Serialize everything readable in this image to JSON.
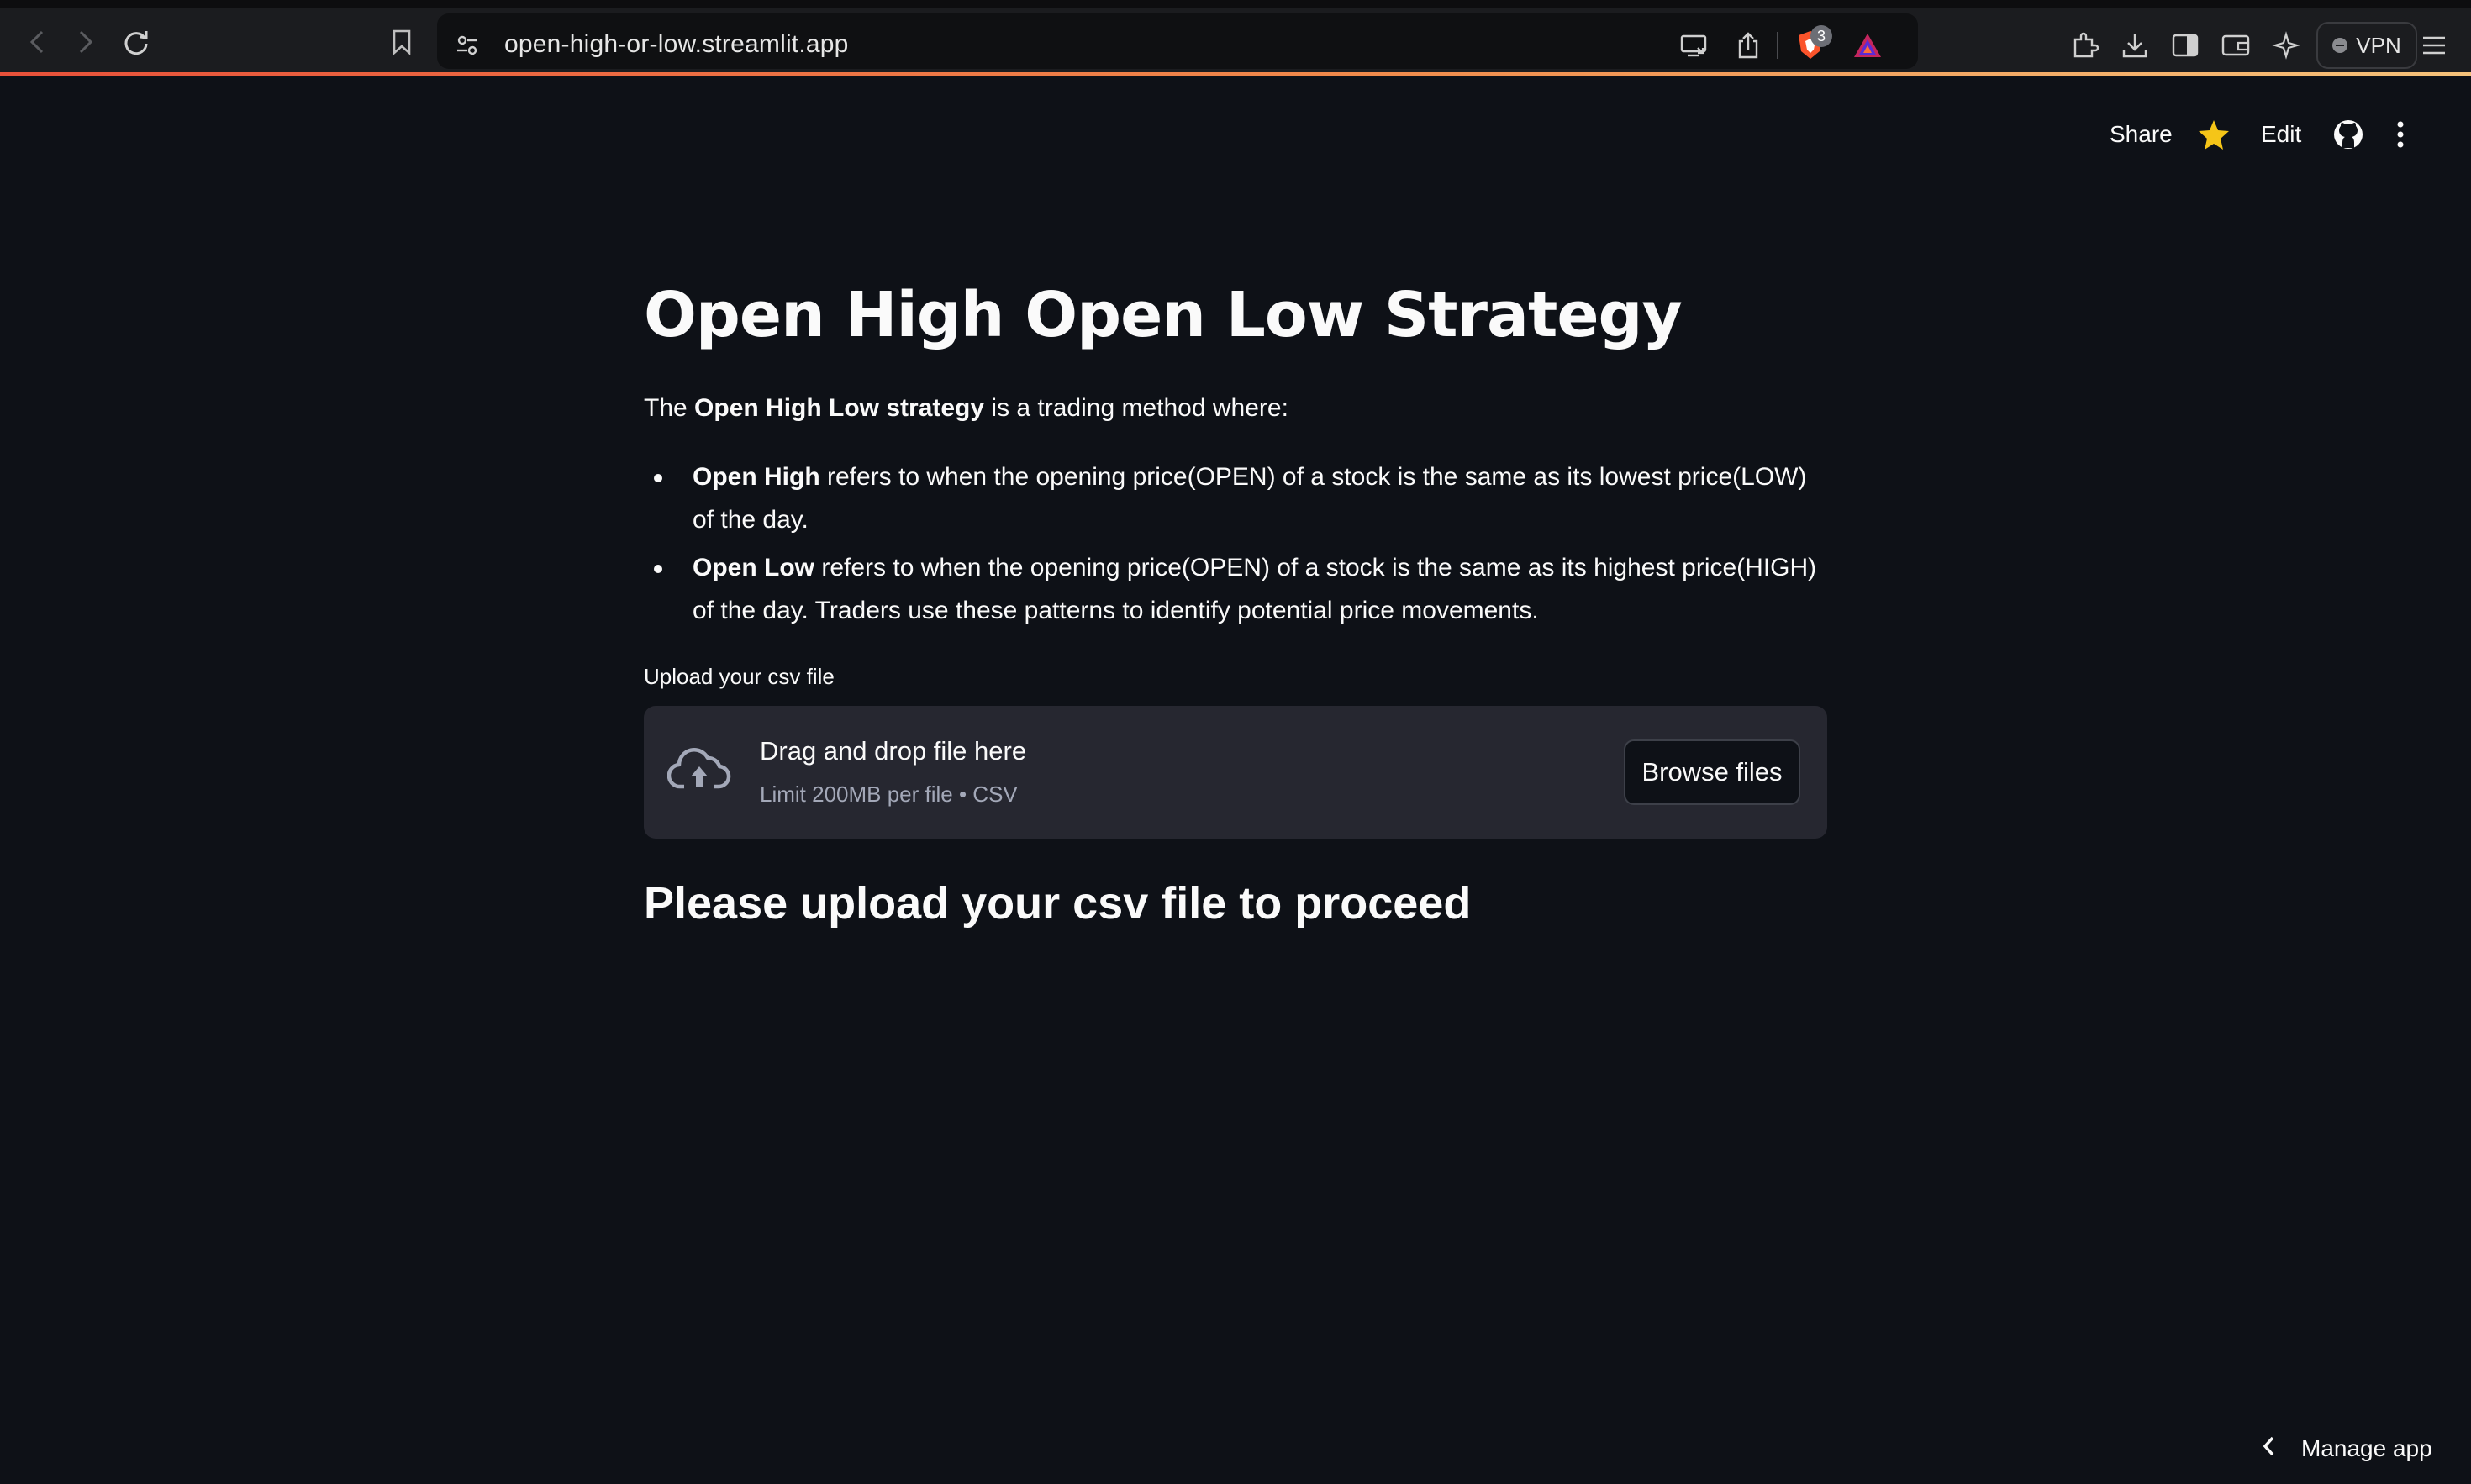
{
  "browser": {
    "url": "open-high-or-low.streamlit.app",
    "brave_badge_count": "3",
    "vpn_label": "VPN"
  },
  "toolbar": {
    "share_label": "Share",
    "edit_label": "Edit"
  },
  "main": {
    "title": "Open High Open Low Strategy",
    "intro_prefix": "The ",
    "intro_bold": "Open High Low strategy",
    "intro_suffix": " is a trading method where:",
    "bullets": [
      {
        "bold": "Open High",
        "text": " refers to when the opening price(OPEN) of a stock is the same as its lowest price(LOW) of the day."
      },
      {
        "bold": "Open Low",
        "text": " refers to when the opening price(OPEN) of a stock is the same as its highest price(HIGH) of the day. Traders use these patterns to identify potential price movements."
      }
    ],
    "upload_label": "Upload your csv file",
    "dropzone": {
      "title": "Drag and drop file here",
      "subtitle": "Limit 200MB per file • CSV",
      "browse_label": "Browse files"
    },
    "status_heading": "Please upload your csv file to proceed"
  },
  "footer": {
    "manage_app_label": "Manage app"
  },
  "colors": {
    "background": "#0e1117",
    "dropzone": "#262730",
    "star": "#f5c518",
    "progress_gradient_start": "#e8513a",
    "progress_gradient_end": "#f5c27a"
  },
  "icons": [
    "back-icon",
    "forward-icon",
    "reload-icon",
    "bookmark-icon",
    "site-settings-icon",
    "cast-icon",
    "share-icon",
    "brave-shields-icon",
    "brave-rewards-icon",
    "extensions-icon",
    "download-icon",
    "sidebar-icon",
    "wallet-icon",
    "leo-ai-icon",
    "menu-icon",
    "star-icon",
    "github-icon",
    "kebab-menu-icon",
    "cloud-upload-icon",
    "chevron-left-icon"
  ]
}
